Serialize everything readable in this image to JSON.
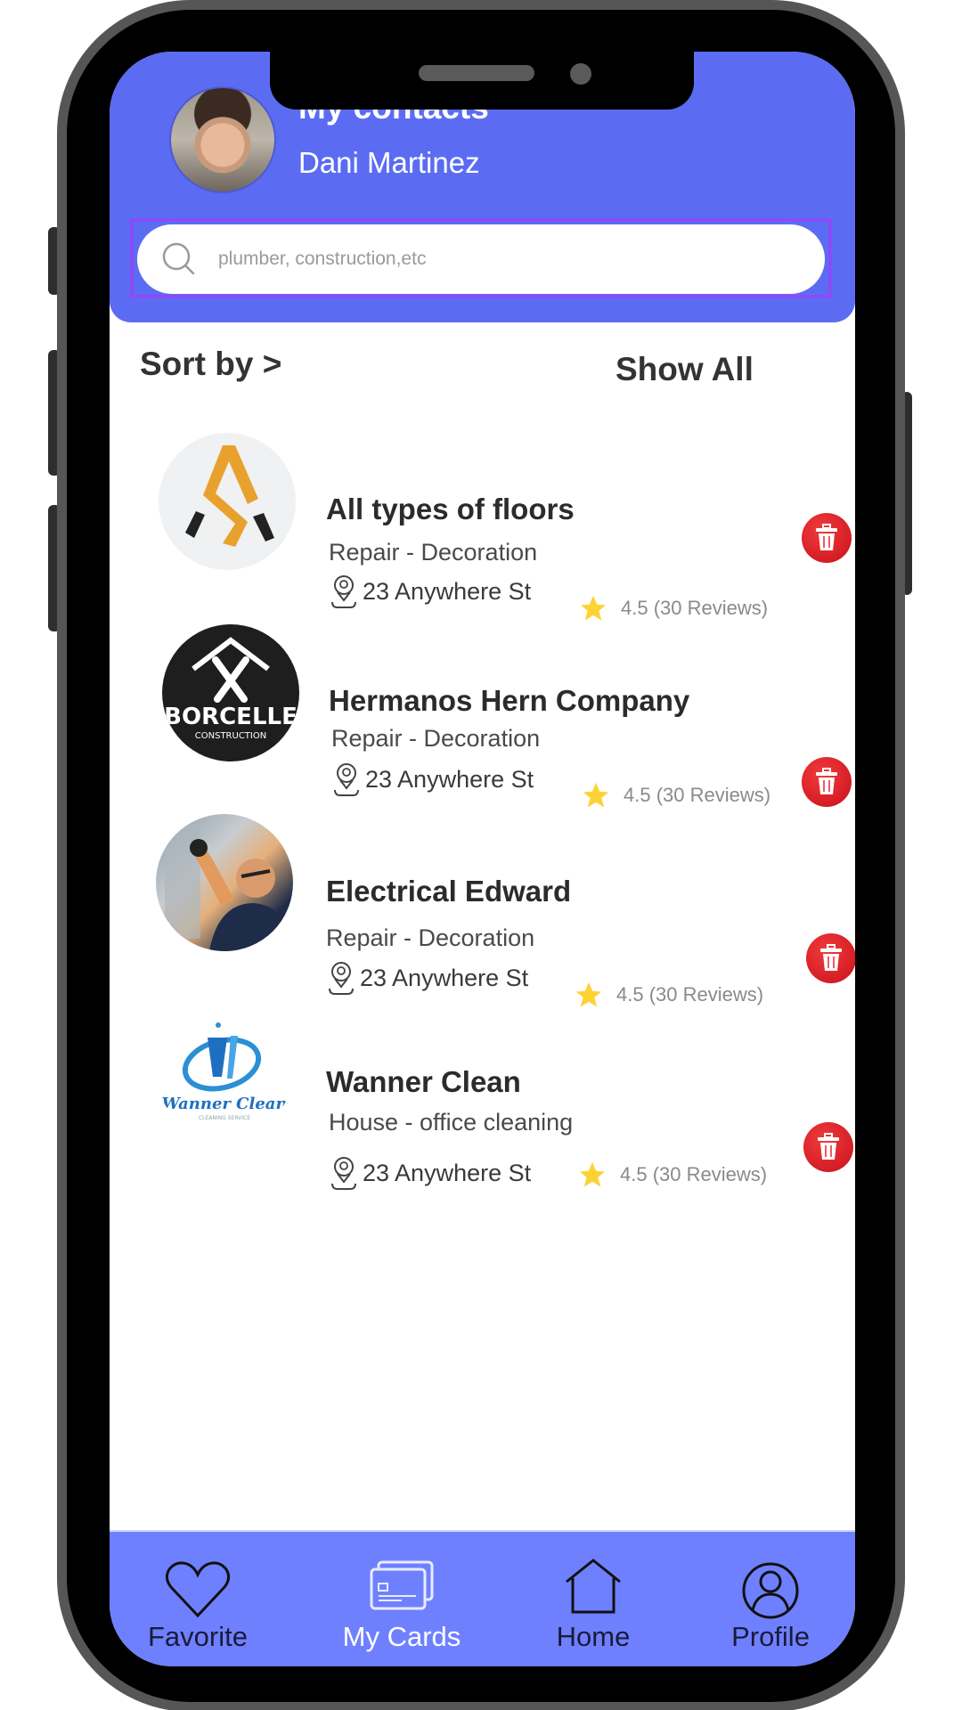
{
  "header": {
    "title": "My contacts",
    "user_name": "Dani Martinez"
  },
  "search": {
    "placeholder": "plumber, construction,etc",
    "value": ""
  },
  "toolbar": {
    "sort_label": "Sort by >",
    "show_all_label": "Show All"
  },
  "contacts": [
    {
      "name": "All types of floors",
      "category": "Repair - Decoration",
      "address": "23 Anywhere St",
      "rating": "4.5 (30 Reviews)",
      "logo": "floors-logo"
    },
    {
      "name": "Hermanos Hern Company",
      "category": "Repair - Decoration",
      "address": "23 Anywhere St",
      "rating": "4.5 (30 Reviews)",
      "logo": "borcelle-logo",
      "logo_text": "BORCELLE",
      "logo_subtext": "CONSTRUCTION"
    },
    {
      "name": "Electrical Edward",
      "category": "Repair - Decoration",
      "address": "23 Anywhere St",
      "rating": "4.5 (30 Reviews)",
      "logo": "electrician-photo"
    },
    {
      "name": "Wanner Clean",
      "category": "House - office cleaning",
      "address": "23 Anywhere St",
      "rating": "4.5 (30 Reviews)",
      "logo": "wanner-clean-logo",
      "logo_text": "Wanner Clean",
      "logo_subtext": "CLEANING SERVICE"
    }
  ],
  "bottom_nav": {
    "items": [
      {
        "label": "Favorite",
        "icon": "heart-icon",
        "active": false
      },
      {
        "label": "My Cards",
        "icon": "cards-icon",
        "active": true
      },
      {
        "label": "Home",
        "icon": "home-icon",
        "active": false
      },
      {
        "label": "Profile",
        "icon": "profile-icon",
        "active": false
      }
    ]
  },
  "colors": {
    "header": "#5b6cf3",
    "bottom_nav": "#6f80ff",
    "search_border": "#8a4cf7",
    "delete": "#d7141f",
    "star": "#fdd235"
  }
}
